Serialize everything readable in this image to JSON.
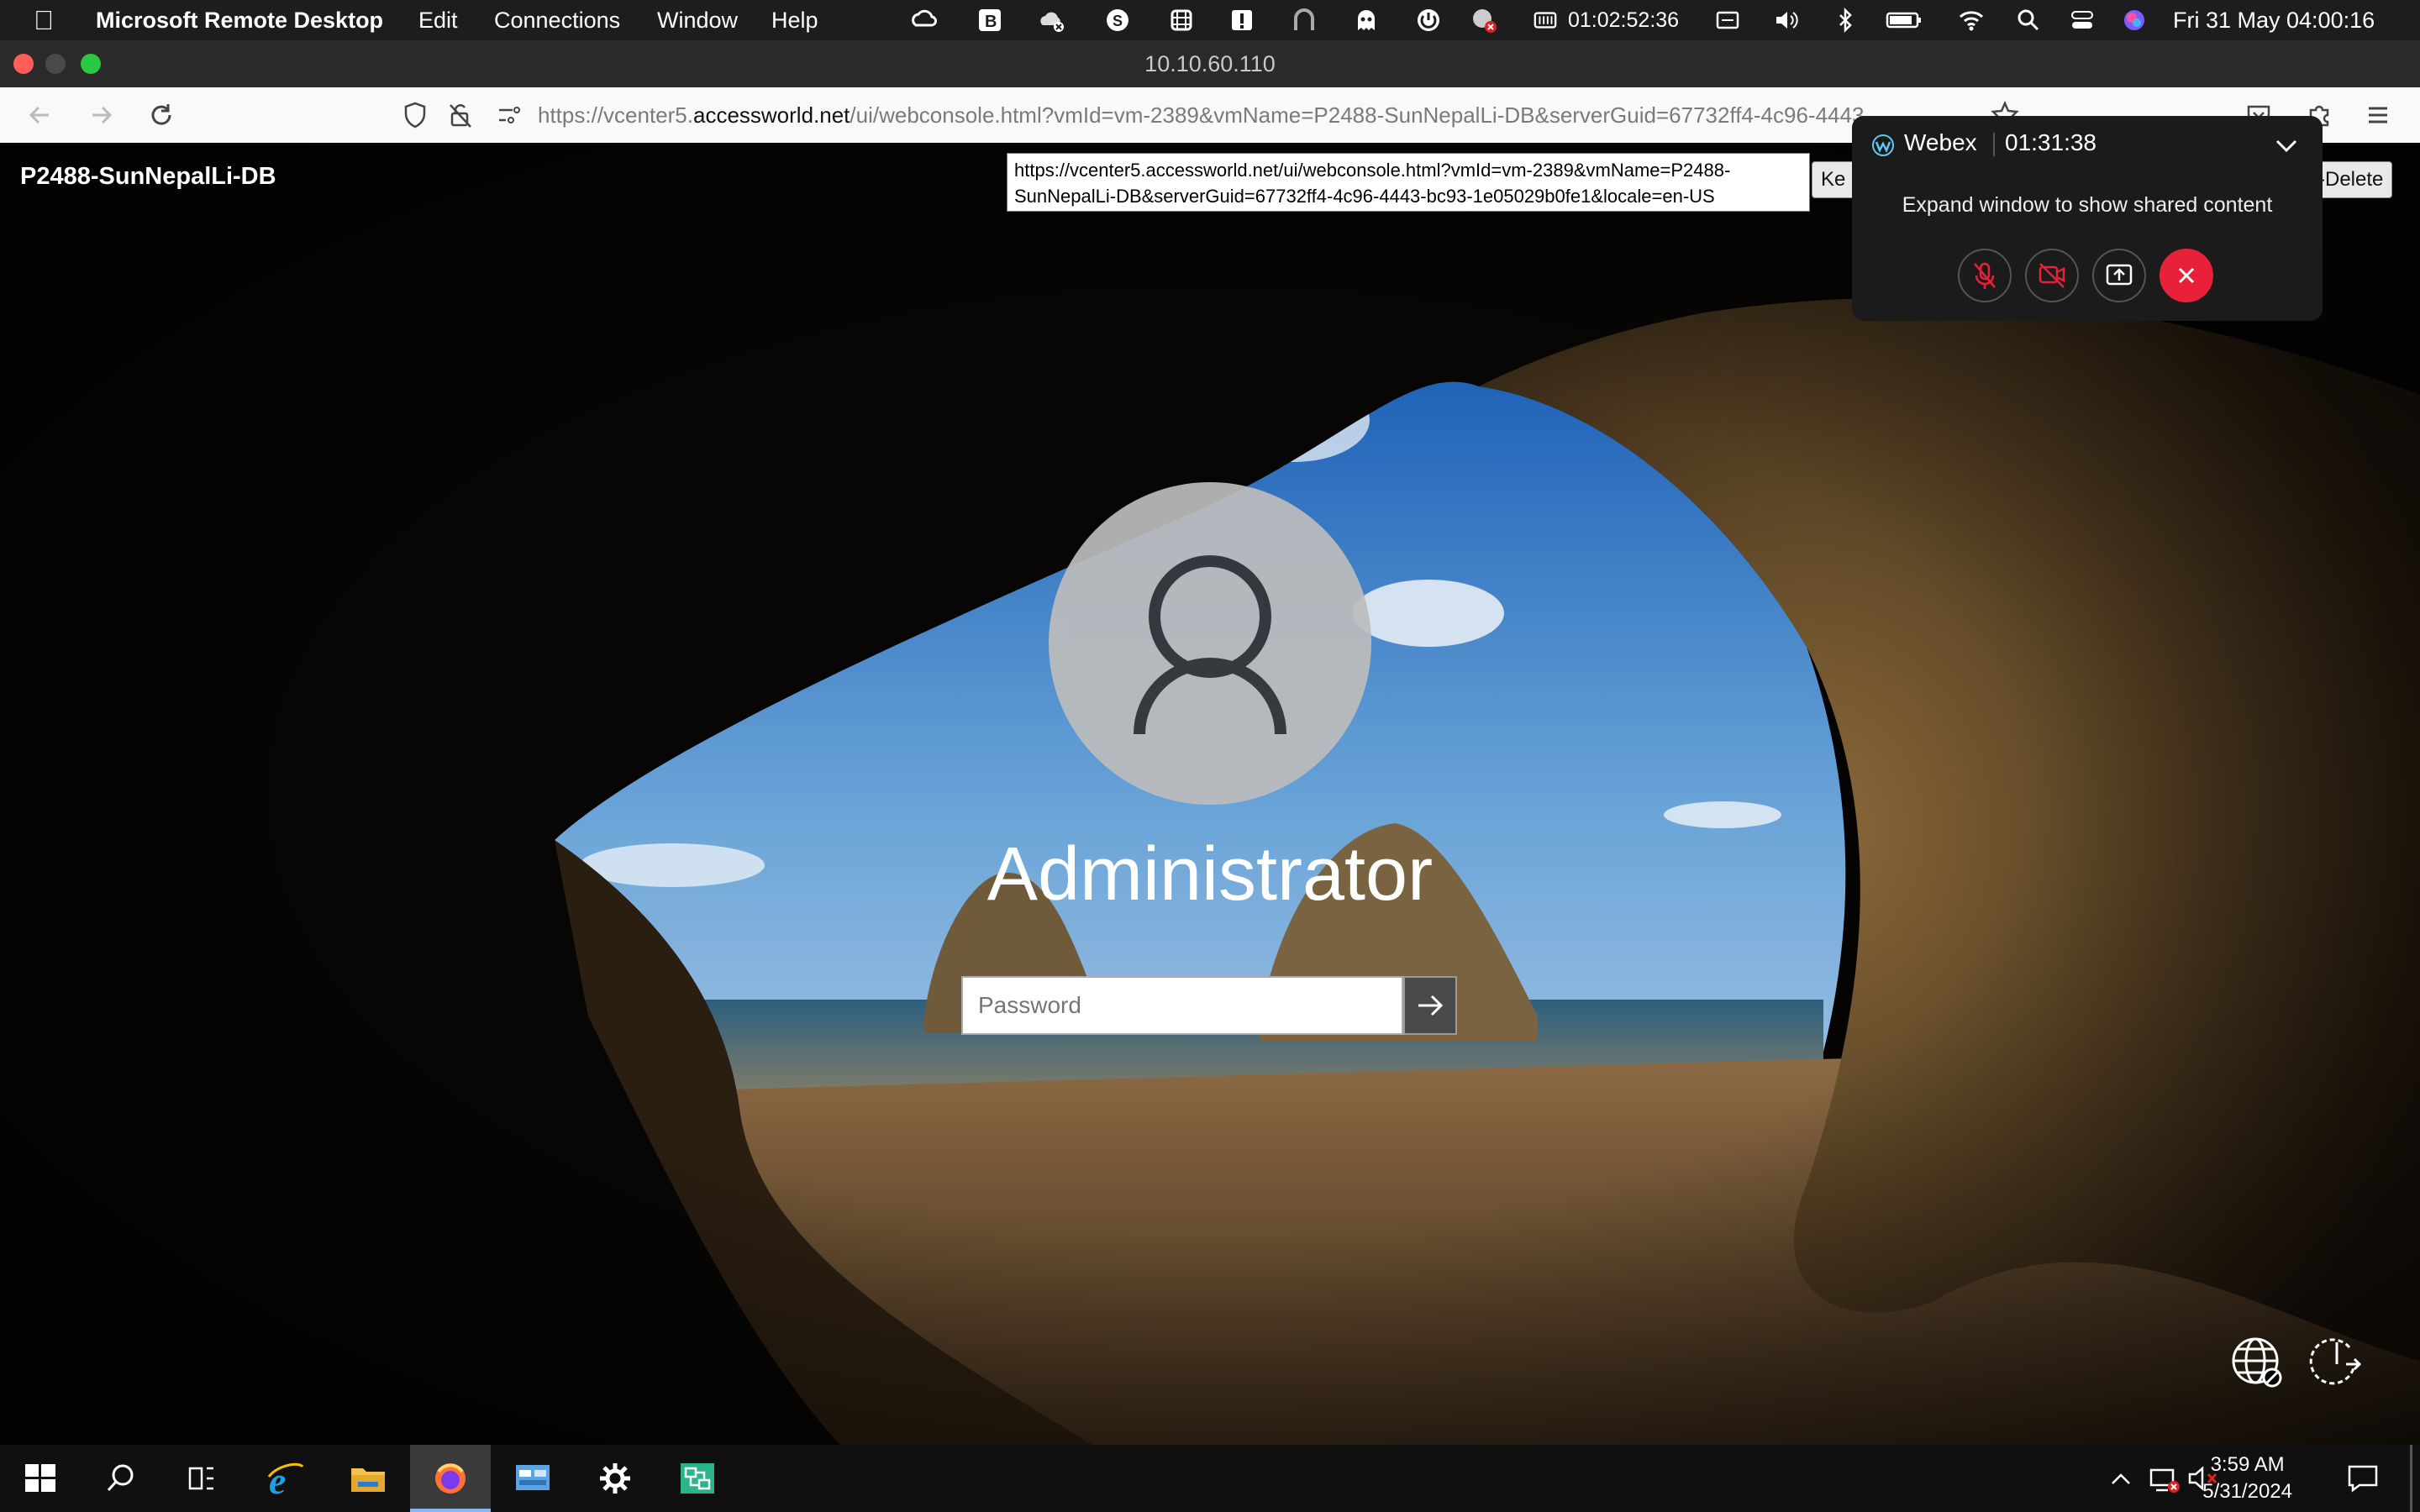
{
  "menubar": {
    "app_name": "Microsoft Remote Desktop",
    "menus": [
      "Edit",
      "Connections",
      "Window",
      "Help"
    ],
    "status_timer": "01:02:52:36",
    "datetime": "Fri 31 May  04:00:16"
  },
  "window": {
    "title": "10.10.60.110"
  },
  "browser": {
    "url_prefix": "https://vcenter5.",
    "url_domain": "accessworld.net",
    "url_rest": "/ui/webconsole.html?vmId=vm-2389&vmName=P2488-SunNepalLi-DB&serverGuid=67732ff4-4c96-4443"
  },
  "console": {
    "vm_name": "P2488-SunNepalLi-DB",
    "tooltip_text": "https://vcenter5.accessworld.net/ui/webconsole.html?vmId=vm-2389&vmName=P2488-SunNepalLi-DB&serverGuid=67732ff4-4c96-4443-bc93-1e05029b0fe1&locale=en-US",
    "keyboard_btn": "Ke",
    "cad_btn": "-Delete"
  },
  "webex": {
    "brand": "Webex",
    "timer": "01:31:38",
    "message": "Expand window to show shared content"
  },
  "login": {
    "username": "Administrator",
    "password_placeholder": "Password"
  },
  "taskbar": {
    "time": "3:59 AM",
    "date": "5/31/2024"
  },
  "colors": {
    "webex_end_call": "#e8203a",
    "menubar_bg": "#1d1d1f",
    "taskbar_bg": "#101010"
  }
}
